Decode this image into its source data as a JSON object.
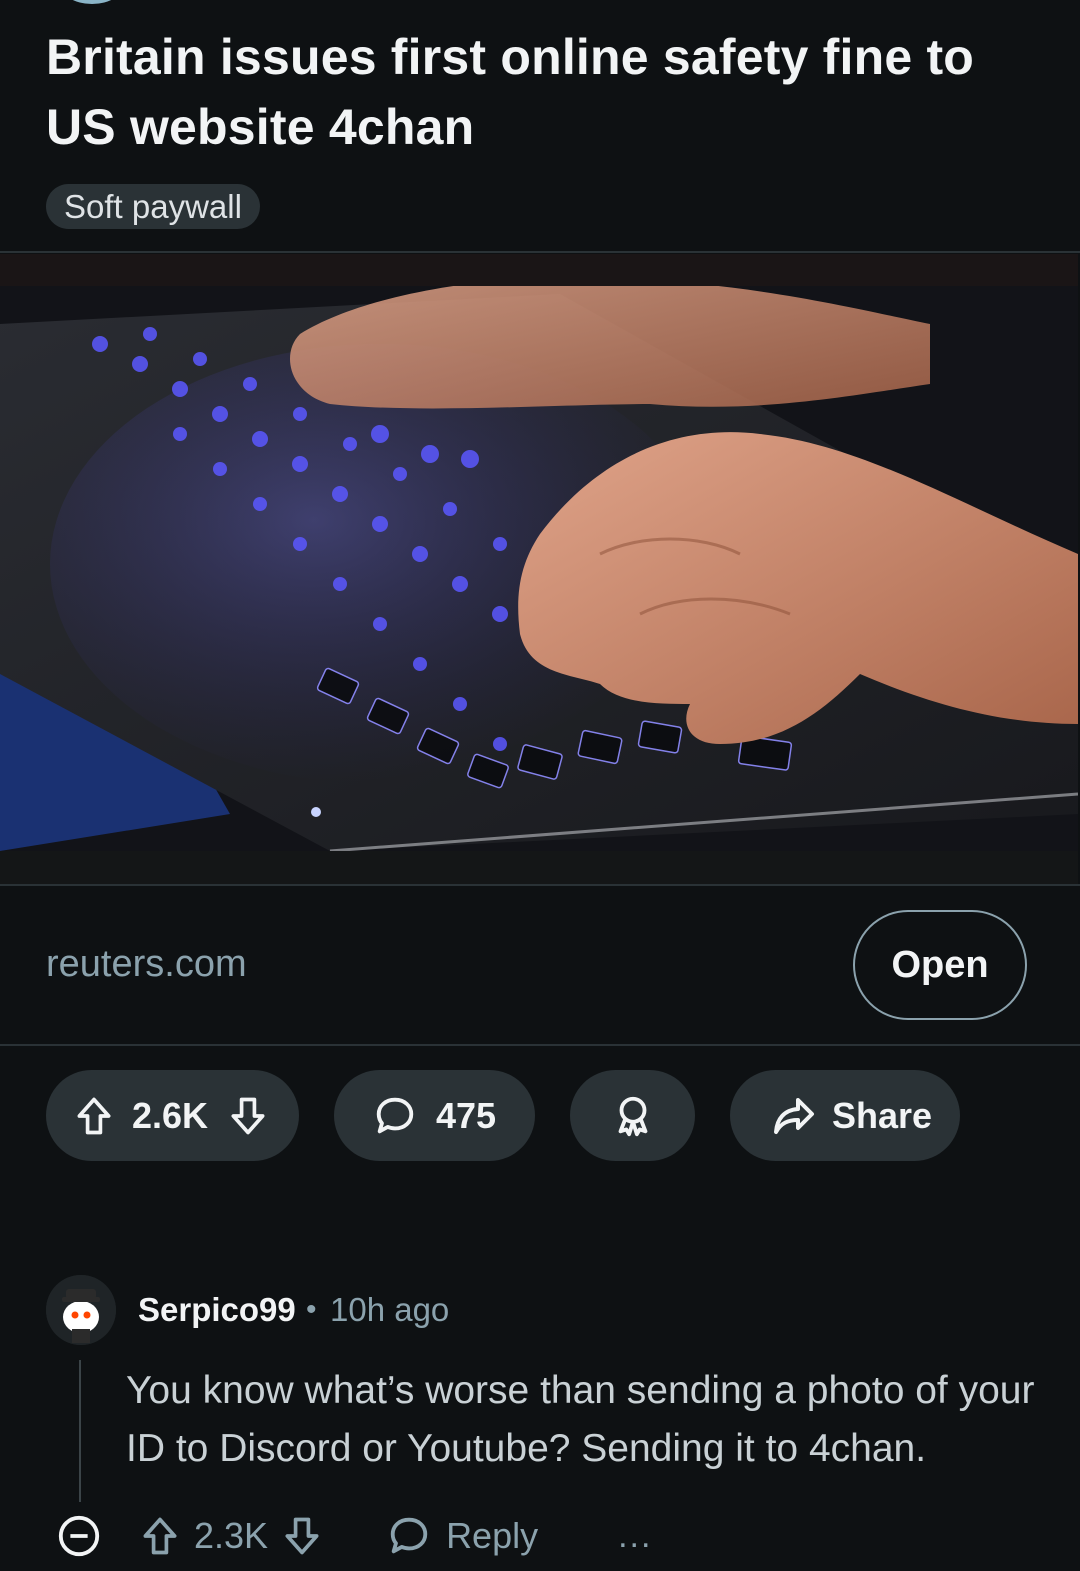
{
  "post": {
    "title": "Britain issues first online safety fine to US website 4chan",
    "flair": "Soft paywall",
    "link_domain": "reuters.com",
    "open_label": "Open",
    "votes": "2.6K",
    "comments": "475",
    "share_label": "Share"
  },
  "comment": {
    "author": "Serpico99",
    "separator": "•",
    "time": "10h ago",
    "body": "You know what’s worse than sending a photo of your ID to Discord or Youtube? Sending it to 4chan.",
    "score": "2.3K",
    "reply_label": "Reply",
    "more": "..."
  },
  "icons": {
    "upvote": "upvote-arrow-icon",
    "downvote": "downvote-arrow-icon",
    "comment": "speech-bubble-icon",
    "award": "award-ribbon-icon",
    "share": "share-arrow-icon",
    "collapse": "collapse-minus-icon"
  },
  "colors": {
    "background": "#0e1113",
    "pill": "#2a3236",
    "muted_text": "#8ba2ad",
    "keyboard_glow": "#6f6cff"
  }
}
